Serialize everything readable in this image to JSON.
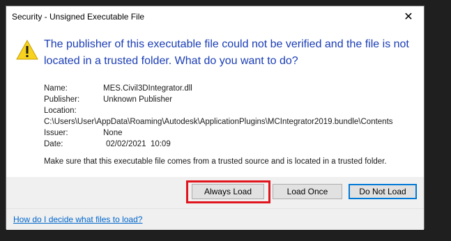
{
  "window": {
    "title": "Security - Unsigned Executable File",
    "close_glyph": "✕"
  },
  "message": {
    "heading": "The publisher of this executable file could not be verified and the file is not located in a trusted folder. What do you want to do?",
    "icon": "warning-icon"
  },
  "details": {
    "name_label": "Name:",
    "name_value": "MES.Civil3DIntegrator.dll",
    "publisher_label": "Publisher:",
    "publisher_value": "Unknown Publisher",
    "location_label": "Location:",
    "location_value": "C:\\Users\\User\\AppData\\Roaming\\Autodesk\\ApplicationPlugins\\MCIntegrator2019.bundle\\Contents",
    "issuer_label": "Issuer:",
    "issuer_value": "None",
    "date_label": "Date:",
    "date_value": "02/02/2021  10:09"
  },
  "advice": "Make sure that this executable file comes from a trusted source and is located in a trusted folder.",
  "buttons": {
    "always_load": "Always Load",
    "load_once": "Load Once",
    "do_not_load": "Do Not Load"
  },
  "help_link": "How do I decide what files to load?",
  "colors": {
    "heading": "#1a3db5",
    "highlight": "#e0141c",
    "link": "#0066cc",
    "default_button_border": "#0078d7"
  }
}
